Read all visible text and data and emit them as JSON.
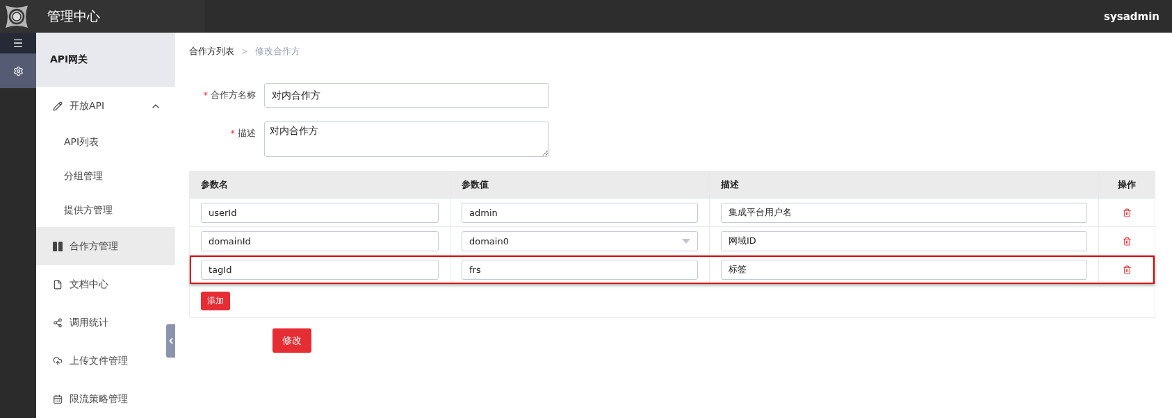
{
  "header": {
    "title": "管理中心",
    "user": "sysadmin"
  },
  "sidebar": {
    "title": "API网关",
    "items": [
      {
        "label": "开放API",
        "selected": false,
        "expanded": true,
        "children": [
          {
            "label": "API列表",
            "selected": false
          },
          {
            "label": "分组管理",
            "selected": false
          },
          {
            "label": "提供方管理",
            "selected": false
          }
        ]
      },
      {
        "label": "合作方管理",
        "selected": true
      },
      {
        "label": "文档中心",
        "selected": false
      },
      {
        "label": "调用统计",
        "selected": false
      },
      {
        "label": "上传文件管理",
        "selected": false
      },
      {
        "label": "限流策略管理",
        "selected": false
      }
    ]
  },
  "breadcrumb": [
    {
      "label": "合作方列表",
      "selected": false
    },
    {
      "label": "修改合作方",
      "selected": true
    }
  ],
  "breadcrumb_separator": ">",
  "required_mark": "*",
  "form": [
    {
      "label": "合作方名称",
      "required": true,
      "kind": "input",
      "value": "对内合作方"
    },
    {
      "label": "描述",
      "required": true,
      "kind": "textarea",
      "value": "对内合作方"
    }
  ],
  "table": {
    "columns": [
      "参数名",
      "参数值",
      "描述",
      "操作"
    ],
    "rows": [
      {
        "name": "userId",
        "value": "admin",
        "kind": "input",
        "description": "集成平台用户名",
        "highlighted": false
      },
      {
        "name": "domainId",
        "value": "domain0",
        "kind": "select",
        "description": "网域ID",
        "highlighted": false
      },
      {
        "name": "tagId",
        "value": "frs",
        "kind": "input",
        "description": "标签",
        "highlighted": true
      }
    ]
  },
  "add_button": "添加",
  "submit_button": "修改"
}
